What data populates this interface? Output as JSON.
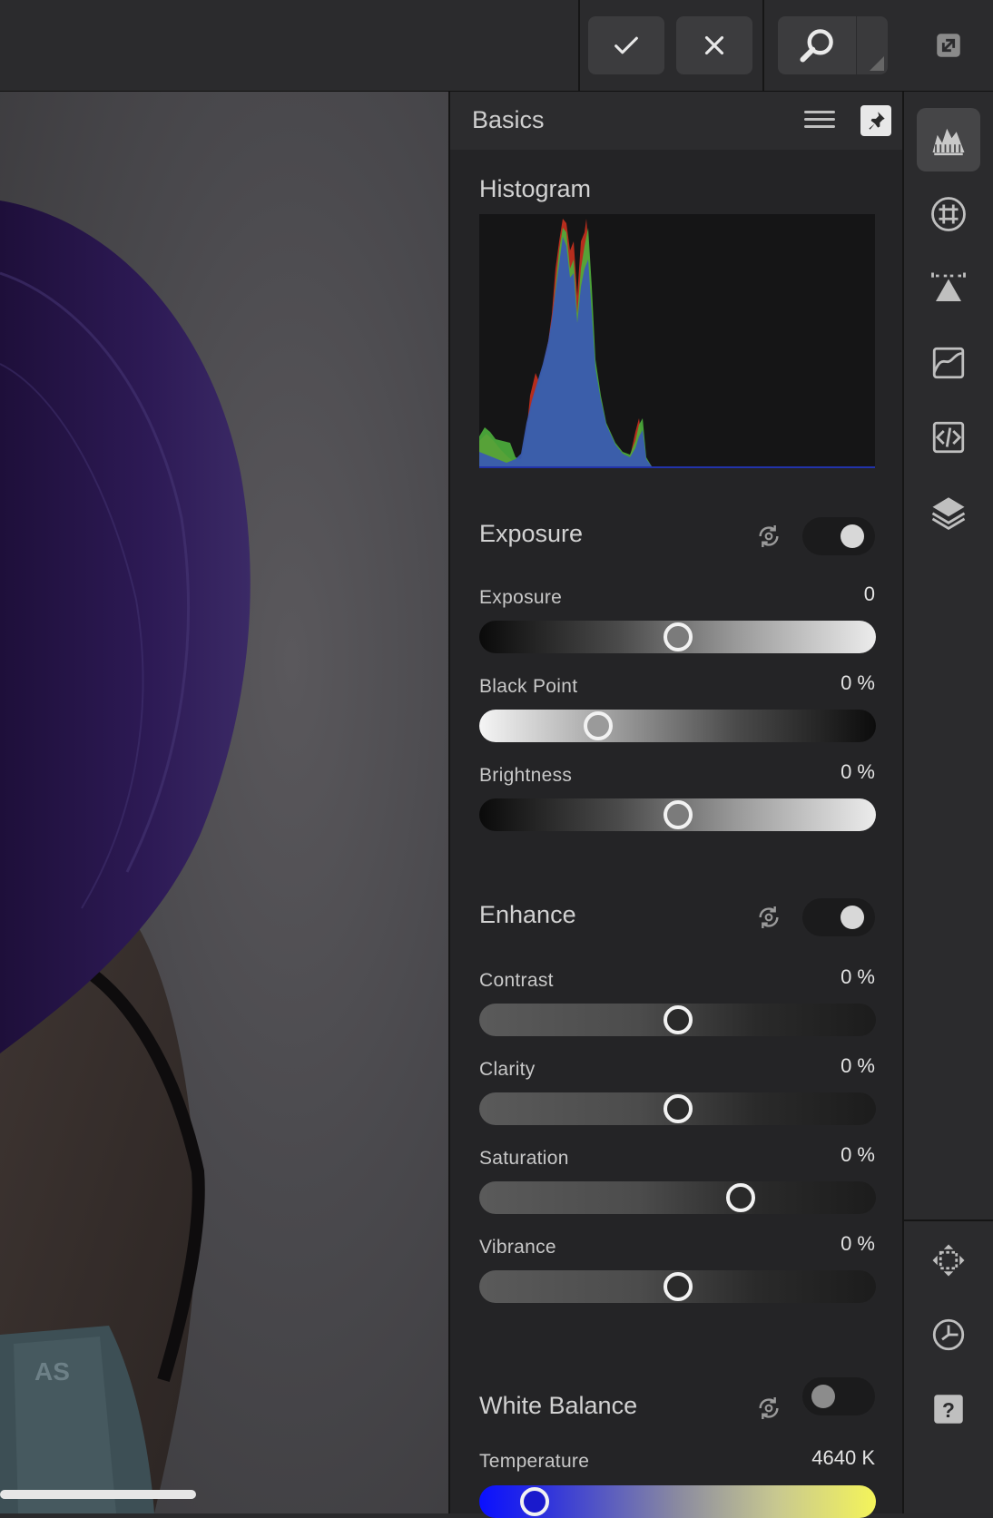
{
  "toolbar": {
    "ok_icon": "checkmark-icon",
    "cancel_icon": "close-icon",
    "zoom_icon": "magnifier-icon",
    "expand_icon": "expand-icon"
  },
  "panel": {
    "title": "Basics",
    "histogram": {
      "title": "Histogram"
    },
    "exposure_section": {
      "title": "Exposure",
      "enabled": true,
      "sliders": [
        {
          "label": "Exposure",
          "value": "0",
          "position": 0.5
        },
        {
          "label": "Black Point",
          "value": "0 %",
          "position": 0.3
        },
        {
          "label": "Brightness",
          "value": "0 %",
          "position": 0.5
        }
      ]
    },
    "enhance_section": {
      "title": "Enhance",
      "enabled": true,
      "sliders": [
        {
          "label": "Contrast",
          "value": "0 %",
          "position": 0.5
        },
        {
          "label": "Clarity",
          "value": "0 %",
          "position": 0.5
        },
        {
          "label": "Saturation",
          "value": "0 %",
          "position": 0.66
        },
        {
          "label": "Vibrance",
          "value": "0 %",
          "position": 0.5
        }
      ]
    },
    "white_balance_section": {
      "title": "White Balance",
      "enabled": false,
      "sliders": [
        {
          "label": "Temperature",
          "value": "4640 K",
          "position": 0.14
        }
      ]
    }
  },
  "right_toolbar": {
    "items": [
      "histogram-icon",
      "grid-icon",
      "sharpen-icon",
      "curves-icon",
      "code-icon",
      "layers-icon"
    ],
    "bottom_items": [
      "move-icon",
      "history-icon",
      "help-icon"
    ]
  },
  "colors": {
    "background": "#2a2a2c",
    "panel": "#242426",
    "accent_toggle": "#d8d8d8",
    "histogram_blue": "#3a5bb0",
    "histogram_green": "#4caf3c",
    "histogram_red": "#c8301e"
  }
}
